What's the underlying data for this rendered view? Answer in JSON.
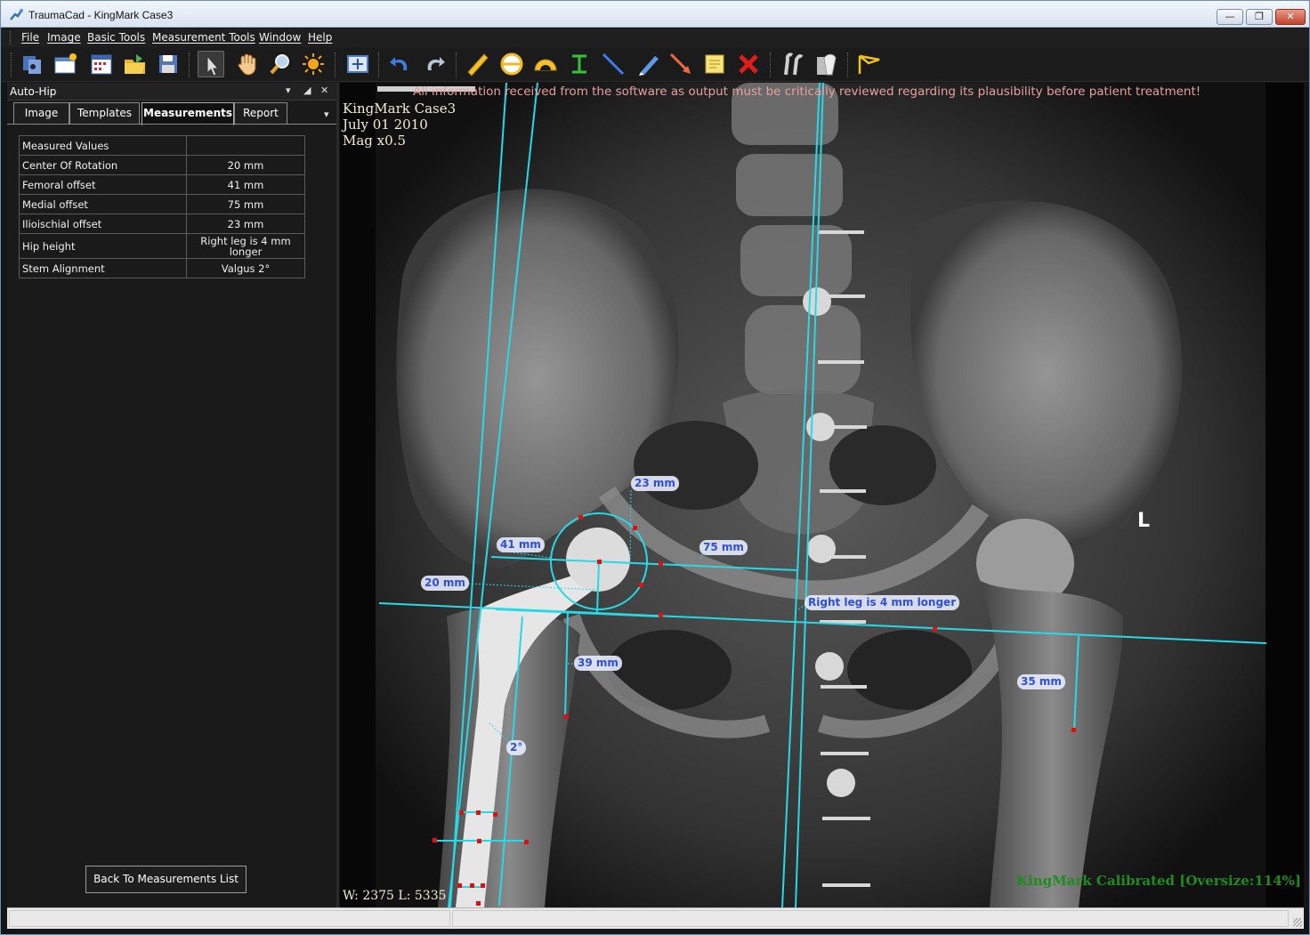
{
  "window": {
    "title": "TraumaCad - KingMark Case3"
  },
  "menu": [
    "File",
    "Image",
    "Basic Tools",
    "Measurement Tools",
    "Window",
    "Help"
  ],
  "toolbar": {
    "icons": [
      "open-images-icon",
      "new-image-icon",
      "calendar-icon",
      "open-folder-icon",
      "save-icon",
      "select-arrow-icon",
      "pan-hand-icon",
      "zoom-icon",
      "brightness-icon",
      "fit-icon",
      "undo-icon",
      "redo-icon",
      "ruler-icon",
      "circle-tool-icon",
      "angle-tool-icon",
      "h-line-tool-icon",
      "line-tool-icon",
      "pen-icon",
      "arrow-tool-icon",
      "note-icon",
      "delete-icon",
      "hip-template-icon",
      "implant-icon",
      "auto-hip-icon"
    ]
  },
  "panel": {
    "title": "Auto-Hip",
    "tabs": [
      "Image",
      "Templates",
      "Measurements",
      "Report"
    ],
    "active_tab": "Measurements",
    "table_header": "Measured Values",
    "rows": [
      {
        "label": "Center Of Rotation",
        "value": "20 mm"
      },
      {
        "label": "Femoral offset",
        "value": "41 mm"
      },
      {
        "label": "Medial offset",
        "value": "75 mm"
      },
      {
        "label": "Ilioischial offset",
        "value": "23 mm"
      },
      {
        "label": "Hip height",
        "value": "Right leg is 4 mm longer"
      },
      {
        "label": "Stem Alignment",
        "value": "Valgus 2°"
      }
    ],
    "back_button": "Back To Measurements List"
  },
  "viewer": {
    "warning": "All information received from the software as output must be critically reviewed regarding its plausibility before patient treatment!",
    "case_name": "KingMark Case3",
    "date": "July 01 2010",
    "mag": "Mag x0.5",
    "window_level": "W: 2375 L: 5335",
    "calibration": "KingMark Calibrated [Oversize:114%]",
    "side_marker": "L",
    "labels": {
      "ilioischial": "23 mm",
      "femoral_offset": "41 mm",
      "medial_offset": "75 mm",
      "center_rotation": "20 mm",
      "leg_length": "Right leg is 4 mm longer",
      "right_lt": "39 mm",
      "left_lt": "35 mm",
      "stem_angle": "2°"
    }
  },
  "colors": {
    "measure_line": "#27d9e6",
    "label_text": "#2f4fd6",
    "point": "#e01010",
    "calibrated": "#1e8c1e"
  }
}
